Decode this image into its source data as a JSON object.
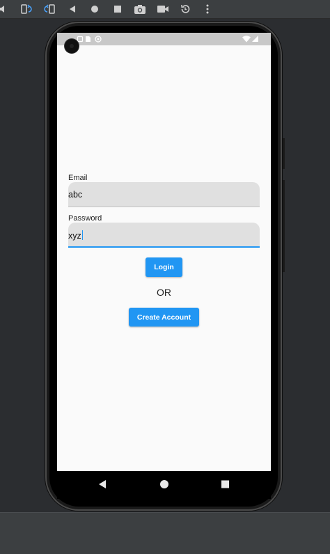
{
  "toolbar": {
    "icons": [
      "volume-icon",
      "rotate-left-icon",
      "rotate-right-icon",
      "back-icon",
      "home-icon",
      "overview-icon",
      "screenshot-icon",
      "record-icon",
      "rewind-icon",
      "more-icon"
    ]
  },
  "status_bar": {
    "time": "",
    "icons": [
      "notification-icon",
      "sim-icon",
      "sync-icon",
      "wifi-icon",
      "signal-icon"
    ]
  },
  "form": {
    "email_label": "Email",
    "email_value": "abc",
    "password_label": "Password",
    "password_value": "xyz",
    "login_label": "Login",
    "or_text": "OR",
    "create_account_label": "Create Account"
  },
  "colors": {
    "accent": "#2196f3",
    "field_background": "#e0e0e0",
    "screen_background": "#fafafa"
  },
  "nav_bar": {
    "icons": [
      "back-triangle-icon",
      "home-circle-icon",
      "recents-square-icon"
    ]
  }
}
